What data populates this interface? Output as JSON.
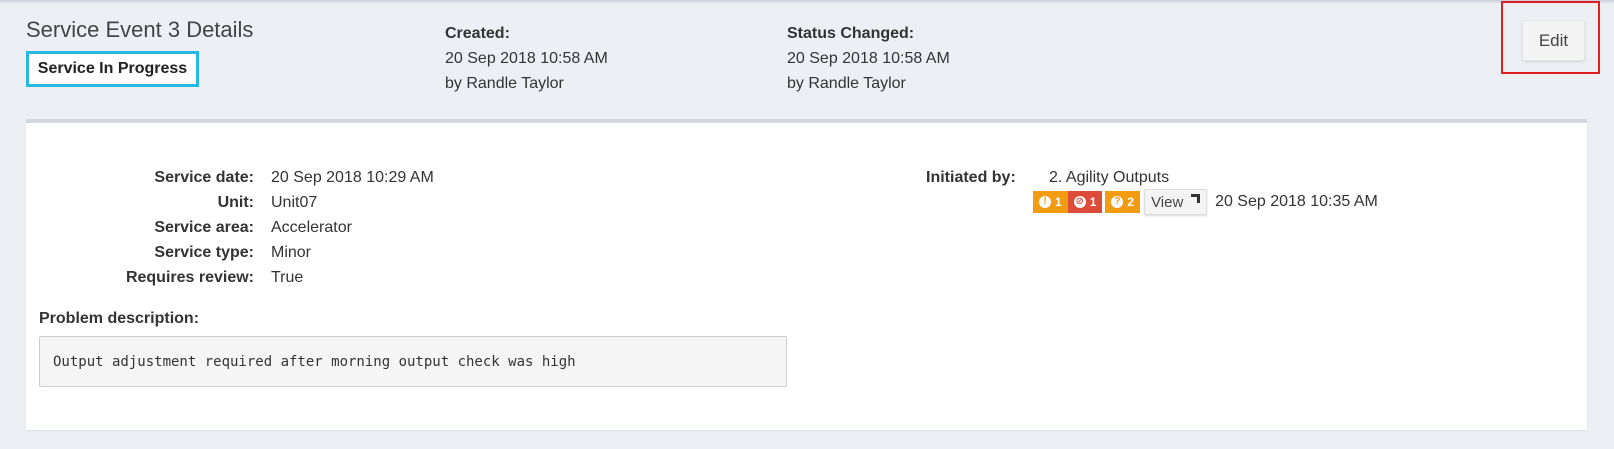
{
  "header": {
    "title": "Service Event 3 Details",
    "status": "Service In Progress",
    "created": {
      "label": "Created:",
      "datetime": "20 Sep 2018 10:58 AM",
      "by": "by Randle Taylor"
    },
    "status_changed": {
      "label": "Status Changed:",
      "datetime": "20 Sep 2018 10:58 AM",
      "by": "by Randle Taylor"
    },
    "edit_label": "Edit"
  },
  "details": [
    {
      "label": "Service date:",
      "value": "20 Sep 2018 10:29 AM"
    },
    {
      "label": "Unit:",
      "value": "Unit07"
    },
    {
      "label": "Service area:",
      "value": "Accelerator"
    },
    {
      "label": "Service type:",
      "value": "Minor"
    },
    {
      "label": "Requires review:",
      "value": "True"
    }
  ],
  "initiated": {
    "label": "Initiated by:",
    "value": "2. Agility Outputs",
    "badges": [
      {
        "icon": "!",
        "icon_name": "exclamation-icon",
        "count": "1",
        "color": "#f39c12"
      },
      {
        "icon": "⊘",
        "icon_name": "ban-icon",
        "count": "1",
        "color": "#dd4b39"
      },
      {
        "icon": "?",
        "icon_name": "question-icon",
        "count": "2",
        "color": "#f39c12"
      }
    ],
    "view_label": "View",
    "view_time": "20 Sep 2018 10:35 AM"
  },
  "problem": {
    "label": "Problem description:",
    "text": "Output adjustment required after morning output check was high"
  },
  "colors": {
    "status_border": "#27b8e6",
    "edit_highlight": "#e02020",
    "warning": "#f39c12",
    "danger": "#dd4b39"
  }
}
